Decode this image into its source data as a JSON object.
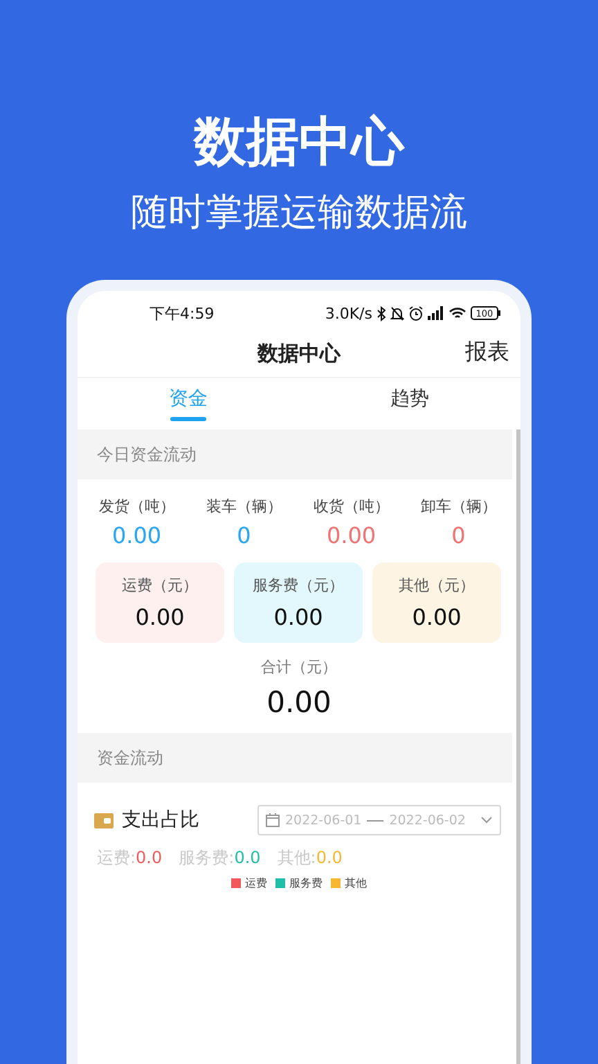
{
  "headline": "数据中心",
  "subheadline": "随时掌握运输数据流",
  "status_bar": {
    "time": "下午4:59",
    "speed": "3.0K/s",
    "battery": "100"
  },
  "nav": {
    "title": "数据中心",
    "action": "报表"
  },
  "tabs": [
    {
      "label": "资金",
      "selected": true
    },
    {
      "label": "趋势",
      "selected": false
    }
  ],
  "today_section": {
    "title": "今日资金流动",
    "stats": [
      {
        "label": "发货（吨）",
        "value": "0.00",
        "color": "#2aa6f2"
      },
      {
        "label": "装车（辆）",
        "value": "0",
        "color": "#2aa6f2"
      },
      {
        "label": "收货（吨）",
        "value": "0.00",
        "color": "#f07474"
      },
      {
        "label": "卸车（辆）",
        "value": "0",
        "color": "#f07474"
      }
    ],
    "fee_cards": [
      {
        "label": "运费（元）",
        "value": "0.00",
        "color": "#fff0f0"
      },
      {
        "label": "服务费（元）",
        "value": "0.00",
        "color": "#e3f8fd"
      },
      {
        "label": "其他（元）",
        "value": "0.00",
        "color": "#fdf4e3"
      }
    ],
    "total": {
      "label": "合计（元）",
      "value": "0.00"
    }
  },
  "flow_section": {
    "title": "资金流动"
  },
  "spend": {
    "title": "支出占比",
    "date_start": "2022-06-01",
    "date_end": "2022-06-02",
    "summary": [
      {
        "label": "运费:",
        "value": "0.0",
        "color": "#f05a5a"
      },
      {
        "label": "服务费:",
        "value": "0.0",
        "color": "#1fbfa8"
      },
      {
        "label": "其他:",
        "value": "0.0",
        "color": "#f7b731"
      }
    ],
    "legend": [
      {
        "label": "运费",
        "color": "#f05a5a"
      },
      {
        "label": "服务费",
        "color": "#1fbfa8"
      },
      {
        "label": "其他",
        "color": "#f7b731"
      }
    ]
  }
}
